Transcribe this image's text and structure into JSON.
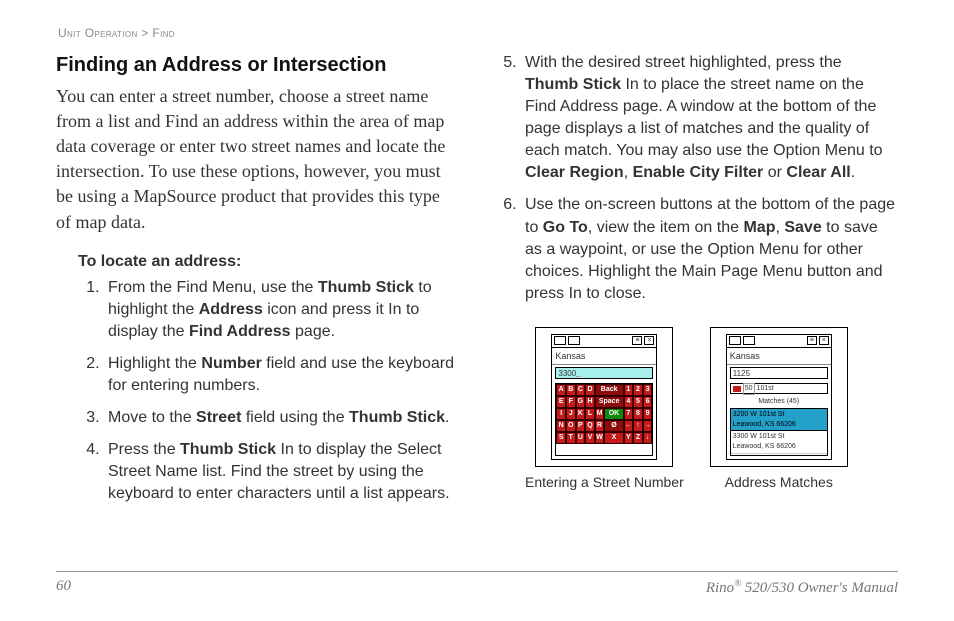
{
  "breadcrumb": {
    "section": "Unit Operation",
    "sep": ">",
    "sub": "Find"
  },
  "heading": "Finding an Address or Intersection",
  "intro": "You can enter a street number, choose a street name from a list and Find an address within the area of map data coverage or enter two street names and locate the intersection. To use these options, however, you must be using a MapSource product that provides this type of map data.",
  "subheading": "To locate an address:",
  "steps_left": {
    "s1": {
      "a": "From the Find Menu, use the ",
      "b1": "Thumb Stick",
      "b": " to highlight the ",
      "b2": "Address",
      "c": " icon and press it In to display the ",
      "b3": "Find Address",
      "d": " page."
    },
    "s2": {
      "a": "Highlight the ",
      "b1": "Number",
      "b": " field and use the keyboard for entering numbers."
    },
    "s3": {
      "a": "Move to the ",
      "b1": "Street",
      "b": " field using the ",
      "b2": "Thumb Stick",
      "c": "."
    },
    "s4": {
      "a": "Press the ",
      "b1": "Thumb Stick",
      "b": " In to display the Select Street Name list. Find the street by using the keyboard to enter characters until a list appears."
    }
  },
  "steps_right": {
    "s5": {
      "a": "With the desired street highlighted, press the ",
      "b1": "Thumb Stick",
      "b": " In to place the street name on the Find Address page. A window at the bottom of the page displays a list of matches and the quality of each match. You may also use the Option Menu to ",
      "b2": "Clear Region",
      "c": ", ",
      "b3": "Enable City Filter",
      "d": " or ",
      "b4": "Clear All",
      "e": "."
    },
    "s6": {
      "a": "Use the on-screen buttons at the bottom of the page to ",
      "b1": "Go To",
      "b": ", view the item on the ",
      "b2": "Map",
      "c": ", ",
      "b3": "Save",
      "d": " to save as a waypoint, or use the Option Menu for other choices. Highlight the Main Page Menu button and press In to close."
    }
  },
  "fig1": {
    "state": "Kansas",
    "value": "3300",
    "keys_rows": [
      [
        "A",
        "B",
        "C",
        "D",
        "Back",
        "1",
        "2",
        "3"
      ],
      [
        "E",
        "F",
        "G",
        "H",
        "Space",
        "4",
        "5",
        "6"
      ],
      [
        "I",
        "J",
        "K",
        "L",
        "M",
        "OK",
        "7",
        "8",
        "9"
      ],
      [
        "N",
        "O",
        "P",
        "Q",
        "R",
        "Ø",
        "←",
        "↑",
        "→"
      ],
      [
        "S",
        "T",
        "U",
        "V",
        "W",
        "X",
        "Y",
        "Z",
        "↓"
      ]
    ],
    "caption": "Entering a Street Number"
  },
  "fig2": {
    "state": "Kansas",
    "value": "1125",
    "field2": "101st",
    "matches_label": "Matches (45)",
    "rows": [
      "3200 W 101st St\nLeawood, KS 66206",
      "3300 W 101st St\nLeawood, KS 66206"
    ],
    "caption": "Address Matches"
  },
  "footer": {
    "page": "60",
    "product": "Rino",
    "reg": "®",
    "model": " 520/530 Owner's Manual"
  }
}
